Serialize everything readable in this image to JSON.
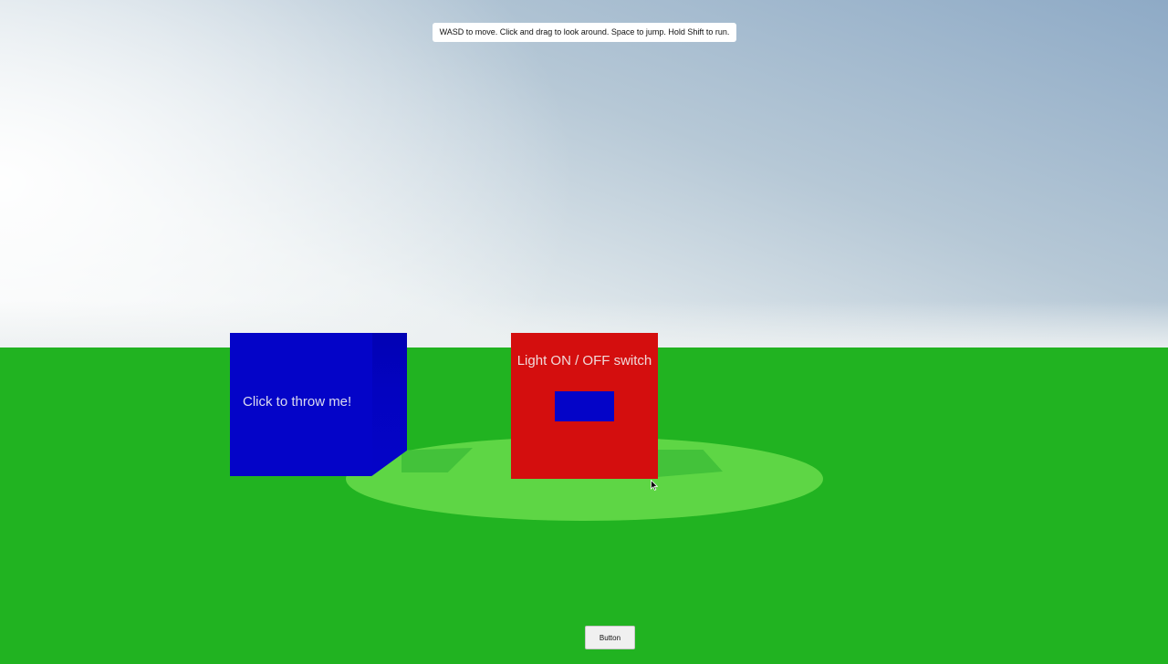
{
  "hud": {
    "instructions": "WASD to move. Click and drag to look around. Space to jump. Hold Shift to run."
  },
  "scene": {
    "throw_cube": {
      "label": "Click to throw me!",
      "color": "#0404c8"
    },
    "switch_cube": {
      "label": "Light ON / OFF switch",
      "color": "#d40e0e",
      "toggle_color": "#0404c8"
    },
    "colors": {
      "ground": "#21b321",
      "light_pool": "#5ed645",
      "sky_top": "#8eaac6",
      "sky_horizon": "#f4f6f6"
    }
  },
  "controls": {
    "button_label": "Button"
  }
}
